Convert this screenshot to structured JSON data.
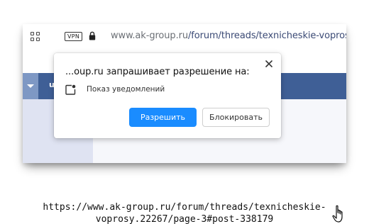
{
  "browser": {
    "vpn_label": "VPN",
    "url_domain": "www.ak-group.ru",
    "url_path": "/forum/threads/texnicheskie-voprosy"
  },
  "site": {
    "nav_letter": "u"
  },
  "permission_popup": {
    "title": "...oup.ru запрашивает разрешение на:",
    "permission_label": "Показ уведомлений",
    "allow_label": "Разрешить",
    "block_label": "Блокировать",
    "close_icon": "close-icon",
    "permission_icon": "notification-bell-icon"
  },
  "caption": {
    "line1": "https://www.ak-group.ru/forum/threads/texnicheskie-",
    "line2": "voprosy.22267/page-3#post-338179"
  },
  "colors": {
    "accent_button": "#1a8cff",
    "site_navbar": "#3f5f96",
    "site_sidebar": "#dfe3f2"
  }
}
